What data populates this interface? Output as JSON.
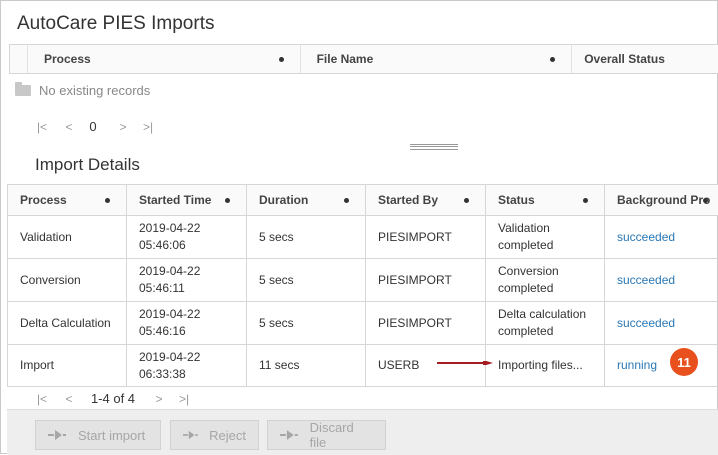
{
  "app": {
    "title": "AutoCare PIES Imports"
  },
  "top_grid": {
    "columns": [
      "Process",
      "File Name",
      "Overall Status"
    ],
    "empty_text": "No existing records",
    "pager": {
      "first": "|<",
      "prev": "<",
      "page": "0",
      "next": ">",
      "last": ">|"
    }
  },
  "details": {
    "title": "Import Details",
    "columns": [
      "Process",
      "Started Time",
      "Duration",
      "Started By",
      "Status",
      "Background Pro"
    ],
    "rows": [
      {
        "process": "Validation",
        "started_time": "2019-04-22 05:46:06",
        "duration": "5 secs",
        "started_by": "PIESIMPORT",
        "status": "Validation completed",
        "background": "succeeded"
      },
      {
        "process": "Conversion",
        "started_time": "2019-04-22 05:46:11",
        "duration": "5 secs",
        "started_by": "PIESIMPORT",
        "status": "Conversion completed",
        "background": "succeeded"
      },
      {
        "process": "Delta Calculation",
        "started_time": "2019-04-22 05:46:16",
        "duration": "5 secs",
        "started_by": "PIESIMPORT",
        "status": "Delta calculation completed",
        "background": "succeeded"
      },
      {
        "process": "Import",
        "started_time": "2019-04-22 06:33:38",
        "duration": "11 secs",
        "started_by": "USERB",
        "status": "Importing files...",
        "background": "running"
      }
    ],
    "pager": {
      "first": "|<",
      "prev": "<",
      "range": "1-4 of 4",
      "next": ">",
      "last": ">|"
    },
    "callout_number": "11"
  },
  "actions": {
    "start_import": "Start import",
    "reject": "Reject",
    "discard_file": "Discard file"
  },
  "colors": {
    "link": "#2a78b6",
    "callout": "#e8501e",
    "arrow": "#a61c24"
  },
  "icons": {
    "empty": "folder-icon",
    "action": "arrow-right-icon"
  }
}
